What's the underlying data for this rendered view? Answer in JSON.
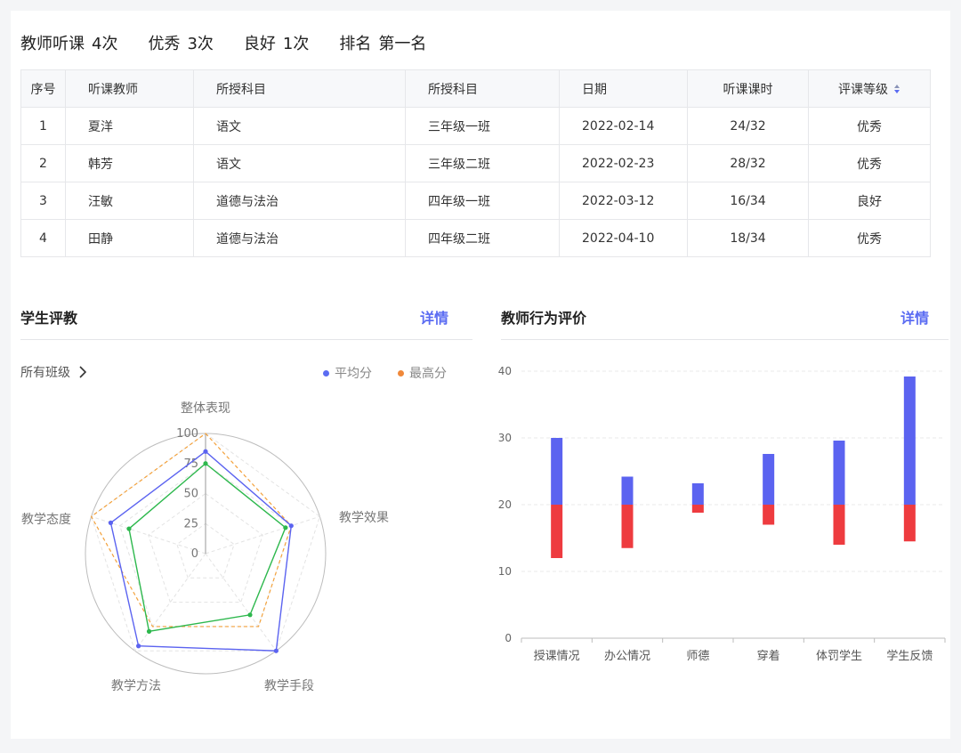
{
  "summary": {
    "listen": {
      "label": "教师听课",
      "value": "4次"
    },
    "excellent": {
      "label": "优秀",
      "value": "3次"
    },
    "good": {
      "label": "良好",
      "value": "1次"
    },
    "rank": {
      "label": "排名",
      "value": "第一名"
    }
  },
  "table": {
    "headers": [
      "序号",
      "听课教师",
      "所授科目",
      "所授科目",
      "日期",
      "听课课时",
      "评课等级"
    ],
    "rows": [
      [
        "1",
        "夏洋",
        "语文",
        "三年级一班",
        "2022-02-14",
        "24/32",
        "优秀"
      ],
      [
        "2",
        "韩芳",
        "语文",
        "三年级二班",
        "2022-02-23",
        "28/32",
        "优秀"
      ],
      [
        "3",
        "汪敏",
        "道德与法治",
        "四年级一班",
        "2022-03-12",
        "16/34",
        "良好"
      ],
      [
        "4",
        "田静",
        "道德与法治",
        "四年级二班",
        "2022-04-10",
        "18/34",
        "优秀"
      ]
    ]
  },
  "student_panel": {
    "title": "学生评教",
    "detail_label": "详情",
    "filter_label": "所有班级",
    "legend": [
      {
        "name": "平均分",
        "color": "#5b6cf2"
      },
      {
        "name": "最高分",
        "color": "#f0883a"
      }
    ]
  },
  "teacher_panel": {
    "title": "教师行为评价",
    "detail_label": "详情"
  },
  "colors": {
    "accent": "#5b6cf2",
    "blue": "#5b63f0",
    "red": "#ee3b3f",
    "green": "#2db84d",
    "orange": "#f3a13b"
  },
  "chart_data": [
    {
      "type": "radar",
      "indicators": [
        "整体表现",
        "教学效果",
        "教学手段",
        "教学方法",
        "教学态度"
      ],
      "max": 100,
      "ticks": [
        "0",
        "25",
        "50",
        "75",
        "100"
      ],
      "series": [
        {
          "name": "平均分",
          "color": "#5b63f0",
          "values": [
            85,
            75,
            100,
            95,
            83
          ]
        },
        {
          "name": "最高分",
          "color": "#f3a13b",
          "values": [
            100,
            75,
            75,
            75,
            100
          ]
        },
        {
          "name": "",
          "color": "#2db84d",
          "values": [
            75,
            70,
            63,
            80,
            67
          ]
        }
      ]
    },
    {
      "type": "bar",
      "categories": [
        "授课情况",
        "办公情况",
        "师德",
        "穿着",
        "体罚学生",
        "学生反馈"
      ],
      "baseline": 20,
      "ylim": [
        0,
        40
      ],
      "yticks": [
        "0",
        "10",
        "20",
        "30",
        "40"
      ],
      "series": [
        {
          "name": "",
          "color": "#5b63f0",
          "values": [
            30,
            24.2,
            23.2,
            27.6,
            29.6,
            39.2
          ]
        },
        {
          "name": "",
          "color": "#ee3b3f",
          "values": [
            12,
            13.5,
            18.8,
            17,
            14,
            14.5
          ]
        }
      ]
    }
  ]
}
